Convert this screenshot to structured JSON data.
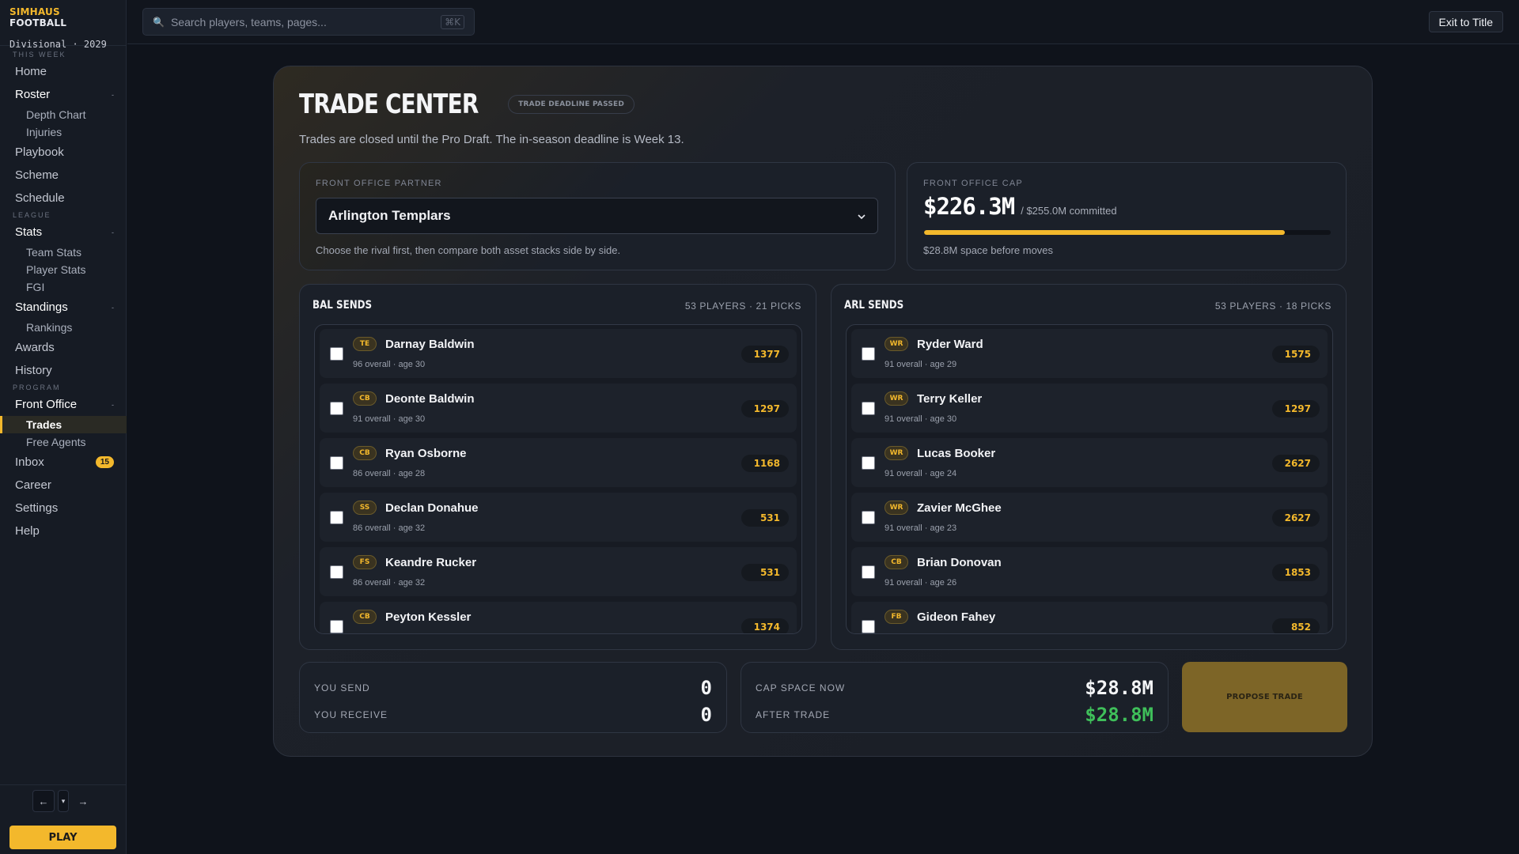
{
  "brand": {
    "title_prefix": "SIMHAUS",
    "title_suffix": " FOOTBALL",
    "subtitle": "Divisional · 2029"
  },
  "nav": {
    "section_this_week": "THIS WEEK",
    "home": "Home",
    "roster": "Roster",
    "depth_chart": "Depth Chart",
    "injuries": "Injuries",
    "playbook": "Playbook",
    "scheme": "Scheme",
    "schedule": "Schedule",
    "section_league": "LEAGUE",
    "stats": "Stats",
    "team_stats": "Team Stats",
    "player_stats": "Player Stats",
    "fgi": "FGI",
    "standings": "Standings",
    "rankings": "Rankings",
    "awards": "Awards",
    "history": "History",
    "section_program": "PROGRAM",
    "front_office": "Front Office",
    "trades": "Trades",
    "free_agents": "Free Agents",
    "inbox": "Inbox",
    "inbox_badge": "15",
    "career": "Career",
    "settings": "Settings",
    "help": "Help",
    "collapse_caret": "-"
  },
  "history_nav": {
    "back": "←",
    "drop": "▾",
    "forward": "→"
  },
  "play_label": "PLAY",
  "search": {
    "placeholder": "Search players, teams, pages...",
    "shortcut": "⌘K",
    "icon": "search-icon"
  },
  "exit_label": "Exit to Title",
  "page": {
    "title": "TRADE CENTER",
    "deadline_badge": "TRADE DEADLINE PASSED",
    "subtitle": "Trades are closed until the Pro Draft. The in-season deadline is Week 13."
  },
  "partner": {
    "label": "FRONT OFFICE PARTNER",
    "selected": "Arlington Templars",
    "help": "Choose the rival first, then compare both asset stacks side by side."
  },
  "cap": {
    "label": "FRONT OFFICE CAP",
    "value": "$226.3M",
    "committed": "/ $255.0M committed",
    "used_fraction": 0.887,
    "note": "$28.8M space before moves"
  },
  "bal_sends": {
    "title": "BAL SENDS",
    "count": "53 PLAYERS · 21 PICKS",
    "players": [
      {
        "pos": "TE",
        "name": "Darnay Baldwin",
        "meta": "96 overall · age 30",
        "value": "1377"
      },
      {
        "pos": "CB",
        "name": "Deonte Baldwin",
        "meta": "91 overall · age 30",
        "value": "1297"
      },
      {
        "pos": "CB",
        "name": "Ryan Osborne",
        "meta": "86 overall · age 28",
        "value": "1168"
      },
      {
        "pos": "SS",
        "name": "Declan Donahue",
        "meta": "86 overall · age 32",
        "value": "531"
      },
      {
        "pos": "FS",
        "name": "Keandre Rucker",
        "meta": "86 overall · age 32",
        "value": "531"
      },
      {
        "pos": "CB",
        "name": "Peyton Kessler",
        "meta": "",
        "value": "1374"
      }
    ]
  },
  "arl_sends": {
    "title": "ARL SENDS",
    "count": "53 PLAYERS · 18 PICKS",
    "players": [
      {
        "pos": "WR",
        "name": "Ryder Ward",
        "meta": "91 overall · age 29",
        "value": "1575"
      },
      {
        "pos": "WR",
        "name": "Terry Keller",
        "meta": "91 overall · age 30",
        "value": "1297"
      },
      {
        "pos": "WR",
        "name": "Lucas Booker",
        "meta": "91 overall · age 24",
        "value": "2627"
      },
      {
        "pos": "WR",
        "name": "Zavier McGhee",
        "meta": "91 overall · age 23",
        "value": "2627"
      },
      {
        "pos": "CB",
        "name": "Brian Donovan",
        "meta": "91 overall · age 26",
        "value": "1853"
      },
      {
        "pos": "FB",
        "name": "Gideon Fahey",
        "meta": "",
        "value": "852"
      }
    ]
  },
  "summary": {
    "you_send_label": "YOU SEND",
    "you_send": "0",
    "you_receive_label": "YOU RECEIVE",
    "you_receive": "0",
    "cap_now_label": "CAP SPACE NOW",
    "cap_now": "$28.8M",
    "after_trade_label": "AFTER TRADE",
    "after_trade": "$28.8M"
  },
  "propose_label": "PROPOSE TRADE",
  "colors": {
    "accent": "#f3b82c",
    "positive": "#3fbf5a",
    "background": "#0f131b"
  }
}
